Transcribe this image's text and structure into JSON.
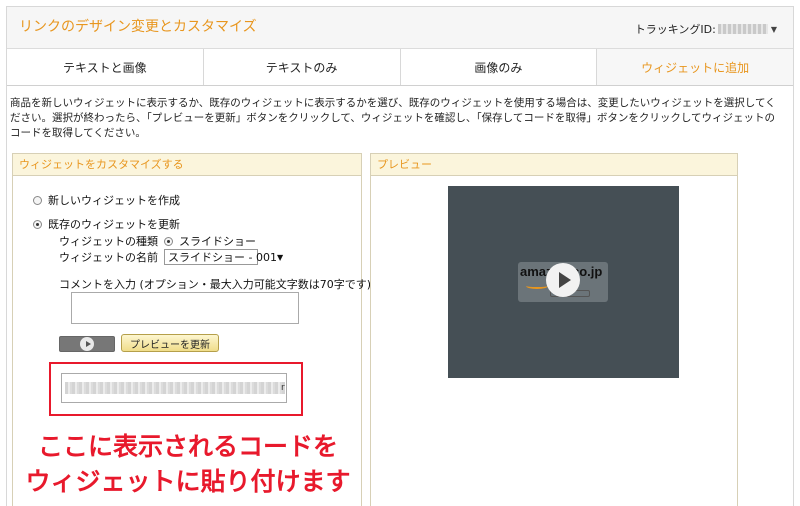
{
  "header": {
    "title": "リンクのデザイン変更とカスタマイズ",
    "tracking_label": "トラッキングID:"
  },
  "tabs": [
    {
      "label": "テキストと画像",
      "active": false
    },
    {
      "label": "テキストのみ",
      "active": false
    },
    {
      "label": "画像のみ",
      "active": false
    },
    {
      "label": "ウィジェットに追加",
      "active": true
    }
  ],
  "description": "商品を新しいウィジェットに表示するか、既存のウィジェットに表示するかを選び、既存のウィジェットを使用する場合は、変更したいウィジェットを選択してください。選択が終わったら、「プレビューを更新」ボタンをクリックして、ウィジェットを確認し、「保存してコードを取得」ボタンをクリックしてウィジェットのコードを取得してください。",
  "customize": {
    "heading": "ウィジェットをカスタマイズする",
    "option_new": "新しいウィジェットを作成",
    "option_existing": "既存のウィジェットを更新",
    "selected_option": "existing",
    "type_label": "ウィジェットの種類",
    "type_value": "スライドショー",
    "name_label": "ウィジェットの名前",
    "name_value": "スライドショー - 001",
    "comment_label": "コメントを入力 (オプション・最大入力可能文字数は70字です)",
    "comment_value": "",
    "preview_button": "プレビューを更新"
  },
  "annotation": {
    "line1": "ここに表示されるコードを",
    "line2": "ウィジェットに貼り付けます",
    "color": "#e8192c"
  },
  "preview": {
    "heading": "プレビュー",
    "logo_text": "amazon.co.jp"
  },
  "colors": {
    "accent": "#e8961e",
    "panel_header_bg": "#fbf5dc",
    "video_bg": "#454f55"
  }
}
